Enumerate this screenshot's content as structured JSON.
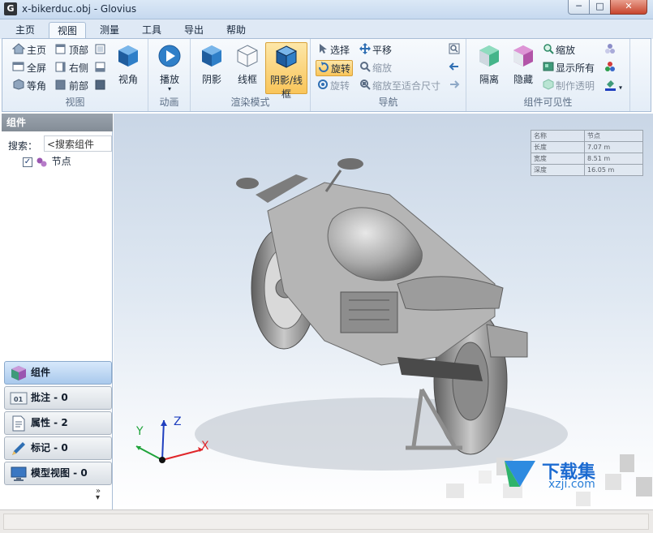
{
  "window": {
    "title": "x-bikerduc.obj - Glovius",
    "app_icon": "G",
    "min": "─",
    "max": "□",
    "close": "✕"
  },
  "tabs": [
    {
      "label": "主页"
    },
    {
      "label": "视图"
    },
    {
      "label": "测量"
    },
    {
      "label": "工具"
    },
    {
      "label": "导出"
    },
    {
      "label": "帮助"
    }
  ],
  "ribbon": {
    "view_group": {
      "label": "视图",
      "home": "主页",
      "top": "顶部",
      "fullscreen": "全屏",
      "right": "右侧",
      "iso": "等角",
      "front": "前部",
      "view_angle": "视角"
    },
    "animation_group": {
      "label": "动画",
      "play": "播放"
    },
    "render_group": {
      "label": "渲染模式",
      "shaded": "阴影",
      "wireframe": "线框",
      "shaded_wireframe": "阴影/线框"
    },
    "navigation_group": {
      "label": "导航",
      "select": "选择",
      "pan": "平移",
      "rotate": "旋转",
      "zoom": "缩放",
      "rotate2": "旋转",
      "zoom_fit": "缩放至适合尺寸"
    },
    "visibility_group": {
      "label": "组件可见性",
      "isolate": "隔离",
      "hide": "隐藏",
      "zoom": "缩放",
      "show_all": "显示所有",
      "make_transparent": "制作透明"
    }
  },
  "left_panel": {
    "title": "组件",
    "search_label": "搜索：",
    "search_value": "<搜索组件",
    "tree_root": "节点",
    "nav": [
      {
        "label": "组件"
      },
      {
        "label": "批注 - 0"
      },
      {
        "label": "属性 - 2"
      },
      {
        "label": "标记 - 0"
      },
      {
        "label": "模型视图 - 0"
      }
    ],
    "more": "»"
  },
  "viewport": {
    "info_table": {
      "header": [
        "名称",
        "节点"
      ],
      "rows": [
        [
          "长度",
          "7.07 m"
        ],
        [
          "宽度",
          "8.51 m"
        ],
        [
          "深度",
          "16.05 m"
        ]
      ]
    },
    "axis": {
      "x": "X",
      "y": "Y",
      "z": "Z"
    }
  },
  "watermark": {
    "logo": "下载集",
    "url": "xzji.com"
  },
  "colors": {
    "accent": "#f9c55a",
    "ribbon_border": "#a8bdd6",
    "axis_x": "#e0262a",
    "axis_y": "#1fa33a",
    "axis_z": "#1f3fbf"
  }
}
